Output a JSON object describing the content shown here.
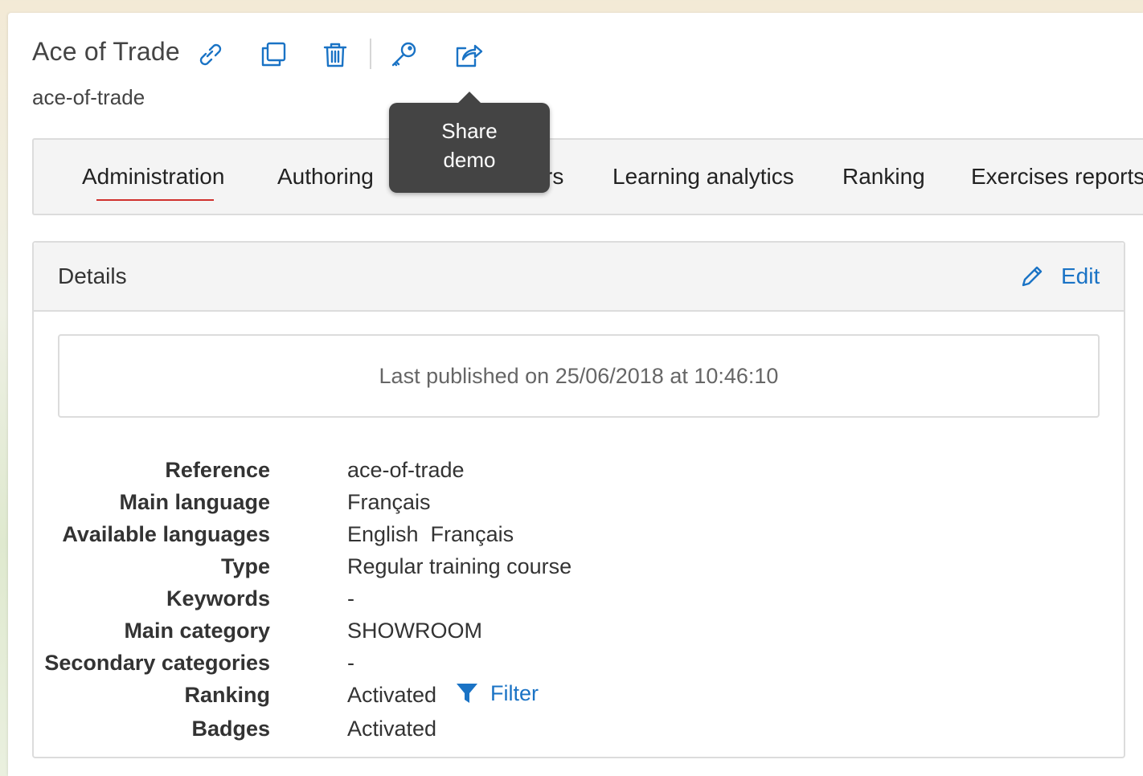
{
  "header": {
    "title": "Ace of Trade",
    "subtitle": "ace-of-trade"
  },
  "toolbar": {
    "icons": [
      "link-icon",
      "copy-icon",
      "trash-icon",
      "key-icon",
      "share-icon"
    ],
    "tooltip_line1": "Share",
    "tooltip_line2": "demo"
  },
  "tabs": [
    {
      "label": "Administration",
      "active": true
    },
    {
      "label": "Authoring"
    },
    {
      "label": "rs"
    },
    {
      "label": "Learning analytics"
    },
    {
      "label": "Ranking"
    },
    {
      "label": "Exercises reports"
    }
  ],
  "details": {
    "title": "Details",
    "edit_label": "Edit",
    "published": "Last published on 25/06/2018 at 10:46:10",
    "rows": [
      {
        "label": "Reference",
        "value": "ace-of-trade"
      },
      {
        "label": "Main language",
        "value": "Français"
      },
      {
        "label": "Available languages",
        "value": "English  Français"
      },
      {
        "label": "Type",
        "value": "Regular training course"
      },
      {
        "label": "Keywords",
        "value": "-"
      },
      {
        "label": "Main category",
        "value": "SHOWROOM"
      },
      {
        "label": "Secondary categories",
        "value": "-"
      },
      {
        "label": "Ranking",
        "value": "Activated"
      },
      {
        "label": "Badges",
        "value": "Activated"
      }
    ],
    "filter_label": "Filter"
  },
  "colors": {
    "accent": "#1a73c5",
    "tab_underline": "#d0312d",
    "tooltip_bg": "#444444"
  }
}
